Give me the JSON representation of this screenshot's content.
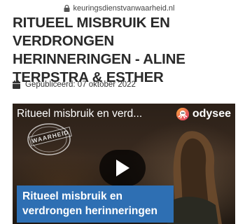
{
  "browser": {
    "url": "keuringsdienstvanwaarheid.nl",
    "lock_icon": "lock-icon"
  },
  "article": {
    "title": "RITUEEL MISBRUIK EN VERDRONGEN HERINNERINGEN - ALINE TERPSTRA & ESTHER",
    "published_label": "Gepubliceerd: 07 oktober 2022",
    "calendar_icon": "calendar-icon"
  },
  "video": {
    "title": "Ritueel misbruik en verd...",
    "brand": "odysee",
    "stamp_text": "WAARHEID",
    "caption_line1": "Ritueel misbruik en",
    "caption_line2": "verdrongen herinneringen",
    "caption_color": "#2e6fb3",
    "play_icon": "play-icon"
  }
}
